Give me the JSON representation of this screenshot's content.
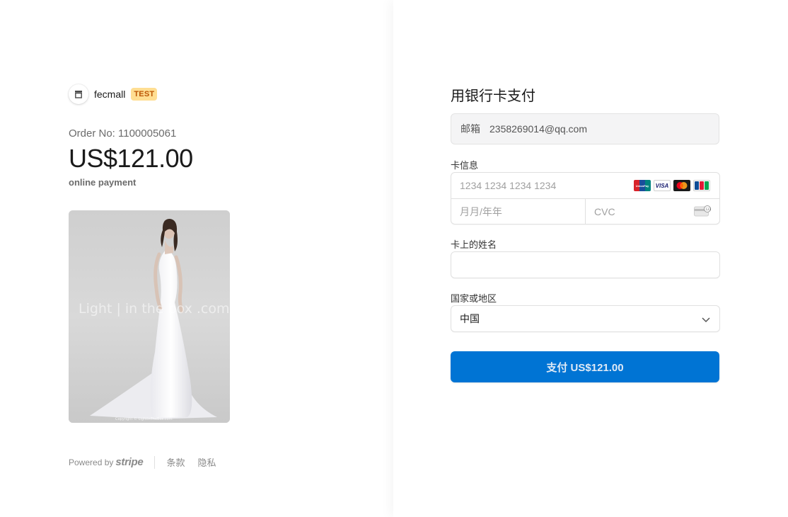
{
  "merchant": {
    "name": "fecmall",
    "badge": "TEST",
    "logo_icon": "store-icon"
  },
  "order": {
    "order_no": "Order No: 1100005061",
    "amount": "US$121.00",
    "description": "online payment",
    "product_image_watermark": "Light in the box .com",
    "product_image_copyright": "Copyright © LightInTheBox.com"
  },
  "footer": {
    "powered_by": "Powered by",
    "brand": "stripe",
    "links": [
      "条款",
      "隐私"
    ]
  },
  "form": {
    "title": "用银行卡支付",
    "email": {
      "label": "邮箱",
      "value": "2358269014@qq.com"
    },
    "card": {
      "label": "卡信息",
      "number_placeholder": "1234 1234 1234 1234",
      "expiry_placeholder": "月月/年年",
      "cvc_placeholder": "CVC",
      "brands": [
        "unionpay-icon",
        "visa-icon",
        "mastercard-icon",
        "jcb-icon"
      ],
      "brand_labels": {
        "unionpay": "UnionPay",
        "visa": "VISA",
        "jcb": "JCB"
      }
    },
    "name": {
      "label": "卡上的姓名",
      "value": ""
    },
    "country": {
      "label": "国家或地区",
      "value": "中国"
    },
    "pay_button": "支付 US$121.00"
  },
  "colors": {
    "accent": "#0074d4",
    "badge_bg": "#ffde92",
    "badge_text": "#bb5504"
  }
}
